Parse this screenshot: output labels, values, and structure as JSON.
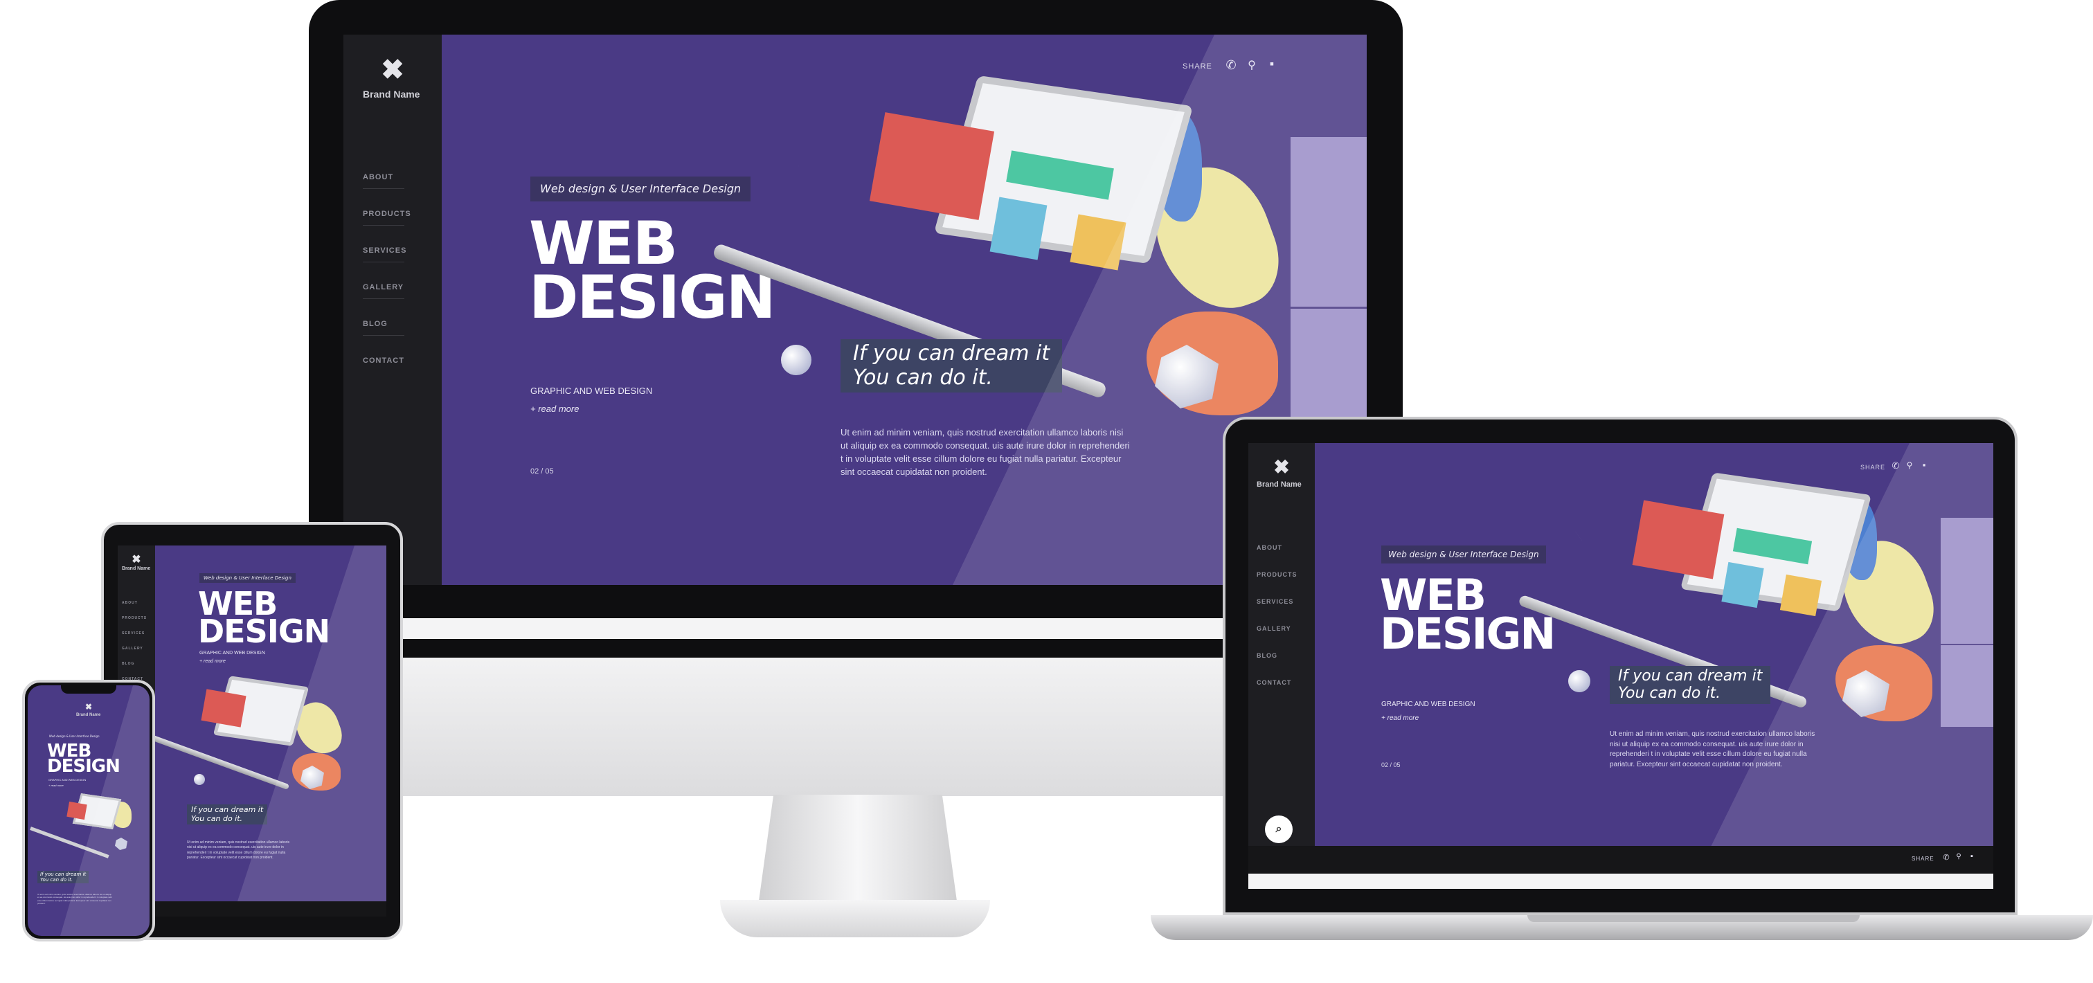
{
  "site": {
    "brand_name": "Brand Name",
    "nav": [
      "ABOUT",
      "PRODUCTS",
      "SERVICES",
      "GALLERY",
      "BLOG",
      "CONTACT"
    ],
    "tagline": "Web design & User Interface Design",
    "headline_line1": "WEB",
    "headline_line2": "DESIGN",
    "subheading": "GRAPHIC AND WEB DESIGN",
    "read_more": "+ read more",
    "pager": "02 / 05",
    "quote_line1": "If you can dream it",
    "quote_line2": "You can do it.",
    "body": "Ut enim ad minim veniam, quis nostrud exercitation ullamco laboris nisi ut aliquip ex ea commodo consequat. uis aute irure dolor in reprehenderi t in voluptate velit esse cillum dolore eu fugiat nulla pariatur. Excepteur sint occaecat cupidatat non proident.",
    "share": "SHARE"
  },
  "icons": {
    "brand": "brand-logo-icon",
    "phone": "phone-icon",
    "location": "location-pin-icon",
    "chat": "chat-bubble-icon",
    "search": "search-icon"
  },
  "colors": {
    "hero_bg": "#4a3a85",
    "sidebar_bg": "#1e1e22",
    "accent_panel": "#9c8fc8",
    "quote_bg": "#3d4464"
  }
}
